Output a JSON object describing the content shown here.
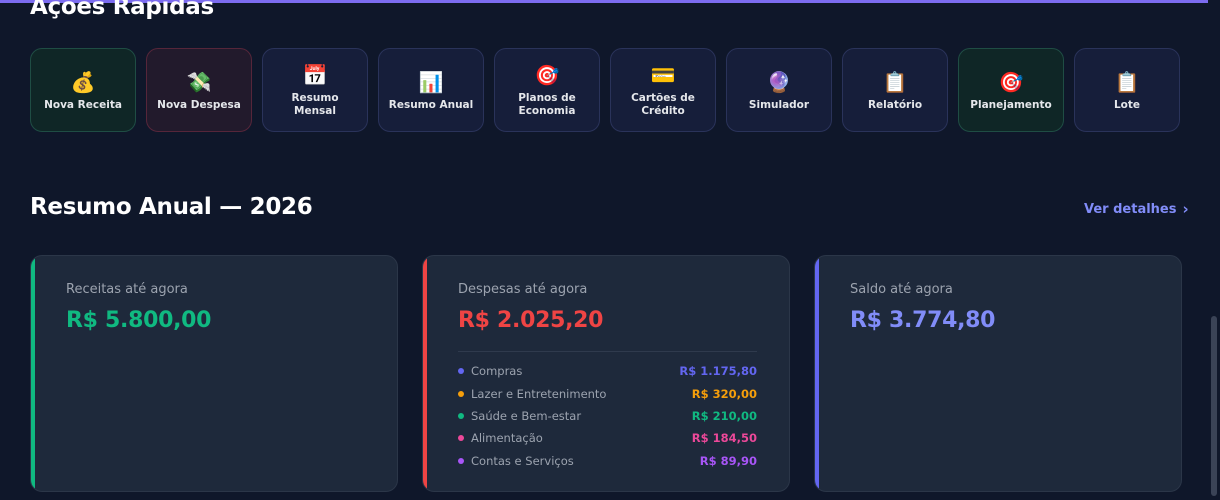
{
  "quick_actions": {
    "title": "Ações Rápidas",
    "items": [
      {
        "label": "Nova Receita",
        "icon": "💰",
        "icon_name": "money-bag-icon",
        "variant": "green"
      },
      {
        "label": "Nova Despesa",
        "icon": "💸",
        "icon_name": "money-wings-icon",
        "variant": "red"
      },
      {
        "label": "Resumo Mensal",
        "icon": "📅",
        "icon_name": "calendar-icon",
        "variant": "default"
      },
      {
        "label": "Resumo Anual",
        "icon": "📊",
        "icon_name": "bar-chart-icon",
        "variant": "default"
      },
      {
        "label": "Planos de Economia",
        "icon": "🎯",
        "icon_name": "target-icon",
        "variant": "default"
      },
      {
        "label": "Cartões de Crédito",
        "icon": "💳",
        "icon_name": "credit-card-icon",
        "variant": "default"
      },
      {
        "label": "Simulador",
        "icon": "🔮",
        "icon_name": "crystal-ball-icon",
        "variant": "default"
      },
      {
        "label": "Relatório",
        "icon": "📋",
        "icon_name": "clipboard-icon",
        "variant": "default"
      },
      {
        "label": "Planejamento",
        "icon": "🎯",
        "icon_name": "target-icon",
        "variant": "green"
      },
      {
        "label": "Lote",
        "icon": "📋",
        "icon_name": "clipboard-icon",
        "variant": "default"
      }
    ]
  },
  "annual_summary": {
    "title": "Resumo Anual — 2026",
    "details_label": "Ver detalhes",
    "income": {
      "label": "Receitas até agora",
      "value": "R$ 5.800,00",
      "color": "#10b981"
    },
    "expenses": {
      "label": "Despesas até agora",
      "value": "R$ 2.025,20",
      "color": "#ef4444",
      "breakdown": [
        {
          "name": "Compras",
          "amount": "R$ 1.175,80",
          "color": "#6366f1"
        },
        {
          "name": "Lazer e Entretenimento",
          "amount": "R$ 320,00",
          "color": "#f59e0b"
        },
        {
          "name": "Saúde e Bem-estar",
          "amount": "R$ 210,00",
          "color": "#10b981"
        },
        {
          "name": "Alimentação",
          "amount": "R$ 184,50",
          "color": "#ec4899"
        },
        {
          "name": "Contas e Serviços",
          "amount": "R$ 89,90",
          "color": "#a855f7"
        }
      ]
    },
    "balance": {
      "label": "Saldo até agora",
      "value": "R$ 3.774,80",
      "color": "#818cf8"
    }
  }
}
